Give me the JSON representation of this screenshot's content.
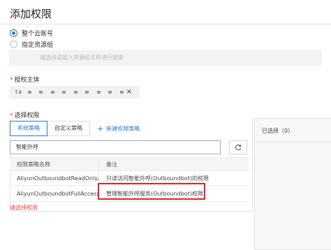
{
  "page": {
    "title": "添加权限"
  },
  "scope": {
    "options": [
      {
        "label": "整个云账号",
        "checked": true
      },
      {
        "label": "指定资源组",
        "checked": false
      }
    ],
    "resource_group_placeholder": "请选择或输入资源组名称进行搜索"
  },
  "principal": {
    "label": "授权主体",
    "required_mark": "*",
    "value_prefix": "ta",
    "remove_symbol": "×"
  },
  "policy_select": {
    "label": "选择权限",
    "required_mark": "*",
    "tabs": [
      {
        "label": "系统策略",
        "active": true
      },
      {
        "label": "自定义策略",
        "active": false
      }
    ],
    "new_policy_label": "新建权限策略",
    "search_value": "智能外呼",
    "table": {
      "headers": [
        "权限策略名称",
        "备注"
      ],
      "rows": [
        {
          "name": "AliyunOutboundbotReadOnlyAccess",
          "note": "只读访问智能外呼(Outboundbot)的权限"
        },
        {
          "name": "AliyunOutboundbotFullAccess",
          "note": "管理智能外呼服务(Outboundbot)权限"
        }
      ]
    },
    "error_message": "请选择权限"
  },
  "selected_panel": {
    "label": "已选择（0）"
  },
  "colors": {
    "accent": "#2a78d6",
    "error": "#e64545",
    "highlight_box": "#d9252a"
  }
}
